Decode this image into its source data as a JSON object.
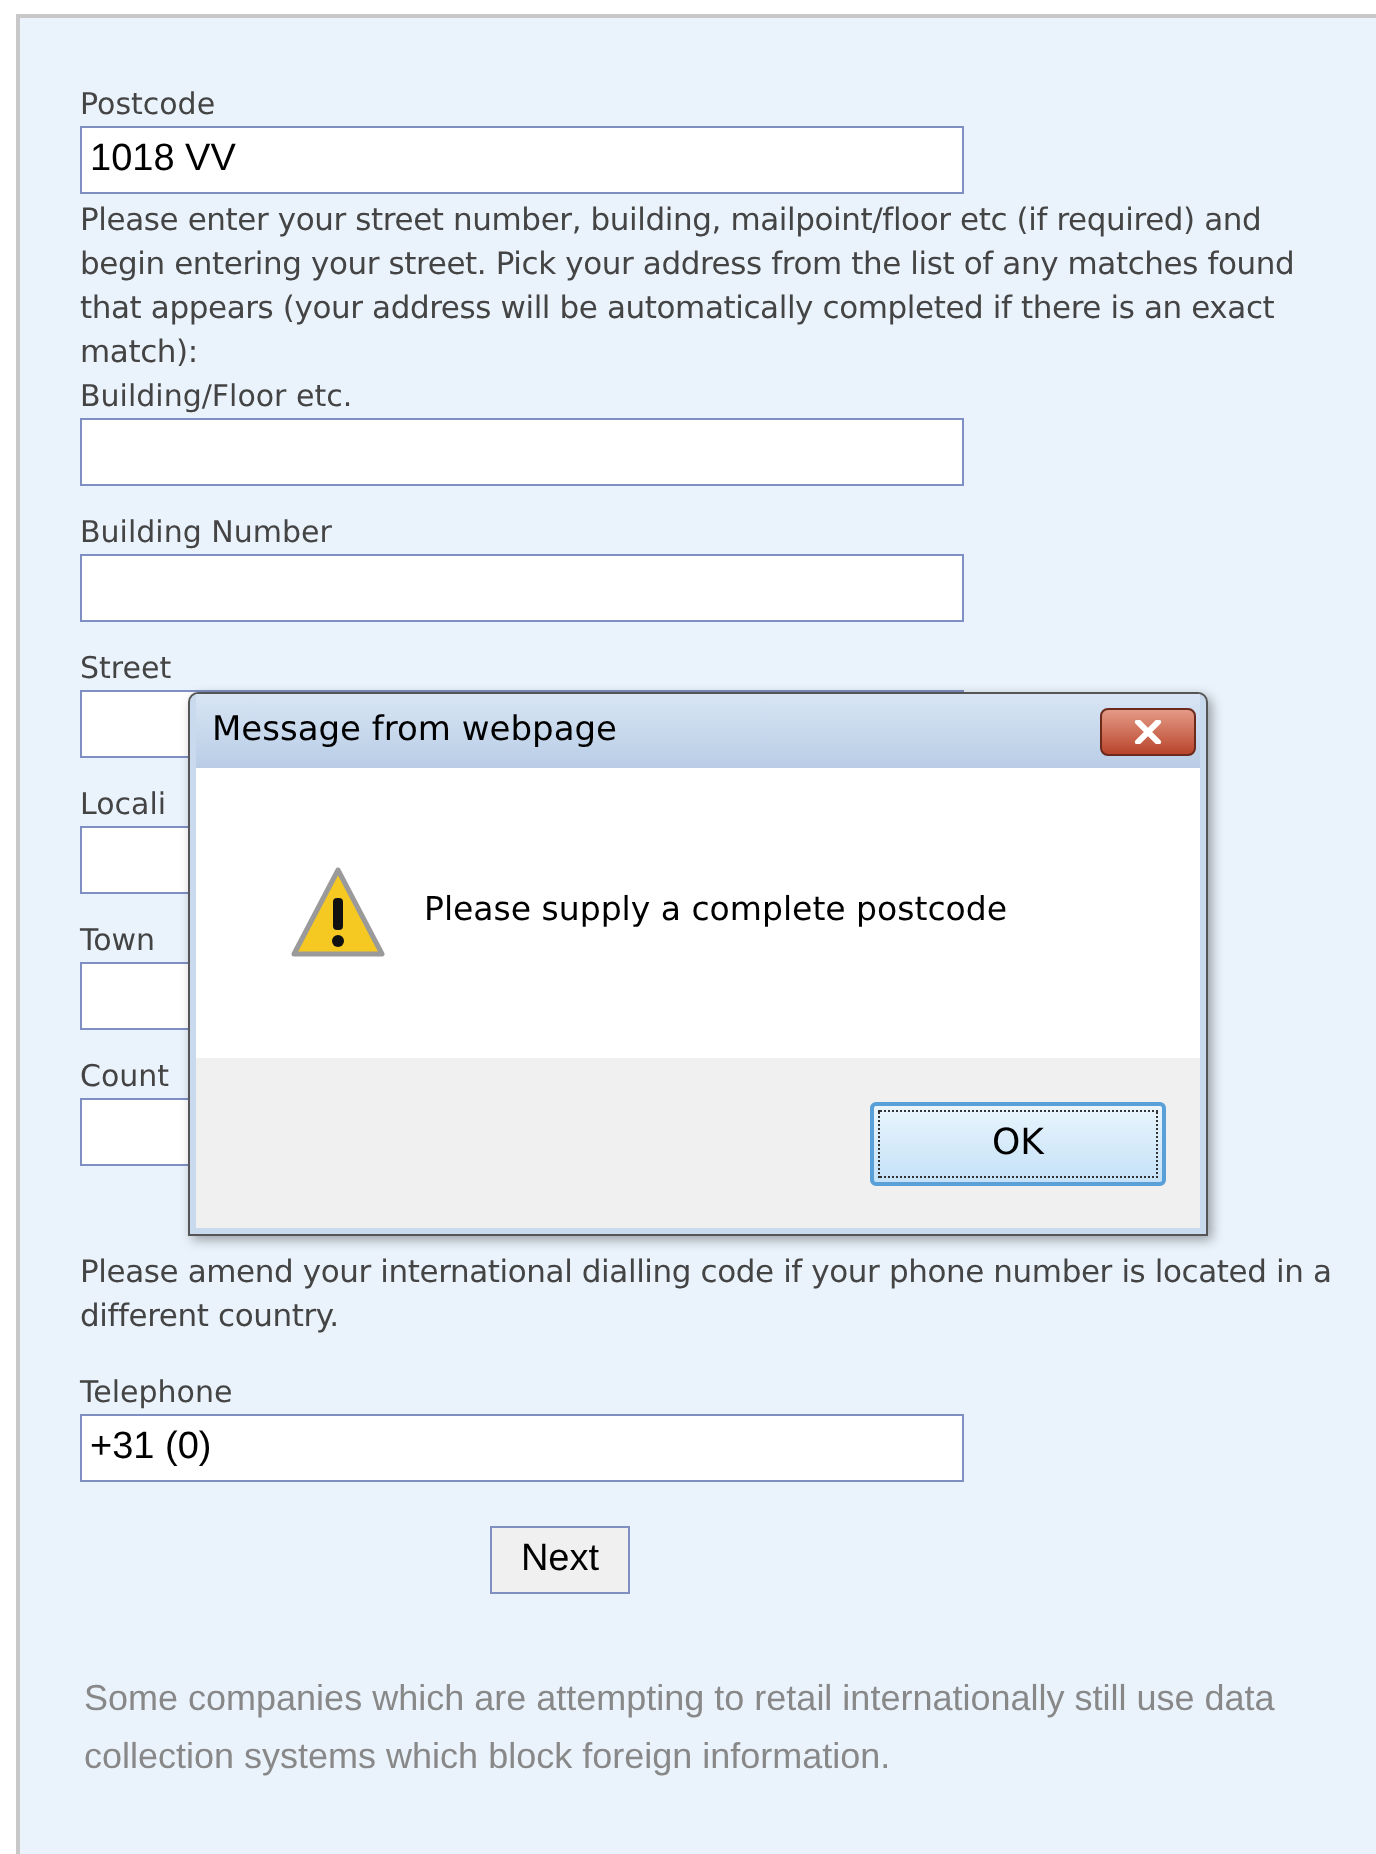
{
  "form": {
    "postcode": {
      "label": "Postcode",
      "value": "1018 VV"
    },
    "instructions": "Please enter your street number, building, mailpoint/floor etc (if required) and begin entering your street. Pick your address from the list of any matches found that appears (your address will be automatically completed if there is an exact match):",
    "address_fields": [
      {
        "label": "Building/Floor etc."
      },
      {
        "label": "Building Number"
      },
      {
        "label": "Street"
      },
      {
        "label": "Locali"
      },
      {
        "label": "Town"
      },
      {
        "label": "Count"
      }
    ],
    "phone_note": "Please amend your international dialling code if your phone number is located in a different country.",
    "telephone": {
      "label": "Telephone",
      "value": "+31 (0)"
    },
    "next_button": "Next"
  },
  "footer_text": "Some companies which are attempting to retail internationally still use data collection systems which block foreign information.",
  "dialog": {
    "title": "Message from webpage",
    "message": "Please supply a complete postcode",
    "ok_button": "OK"
  }
}
